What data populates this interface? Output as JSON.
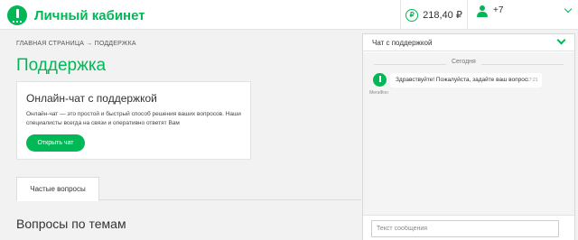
{
  "header": {
    "logo_text": "Личный кабинет",
    "balance": "218,40 ₽",
    "ruble_symbol": "₽",
    "phone": "+7"
  },
  "breadcrumb": "ГЛАВНАЯ СТРАНИЦА → ПОДДЕРЖКА",
  "page_title": "Поддержка",
  "chat_card": {
    "title": "Онлайн-чат с поддержкой",
    "text": "Онлайн-чат — это простой и быстрый способ решения ваших вопросов. Наши специалисты всегда на связи и оперативно ответят Вам",
    "button": "Открыть чат"
  },
  "tabs": [
    "Частые вопросы"
  ],
  "topics_title": "Вопросы по темам",
  "chat": {
    "title": "Чат с поддержкой",
    "date_divider": "Сегодня",
    "bot_name": "МегаФон",
    "message": "Здравствуйте! Пожалуйста, задайте ваш вопрос.",
    "time": "17:21",
    "input_placeholder": "Текст сообщения"
  },
  "colors": {
    "brand": "#00b956",
    "background": "#f2f2f2"
  },
  "icons": [
    "logo-icon",
    "ruble-icon",
    "user-icon",
    "chevron-down-icon",
    "bot-avatar-icon"
  ]
}
